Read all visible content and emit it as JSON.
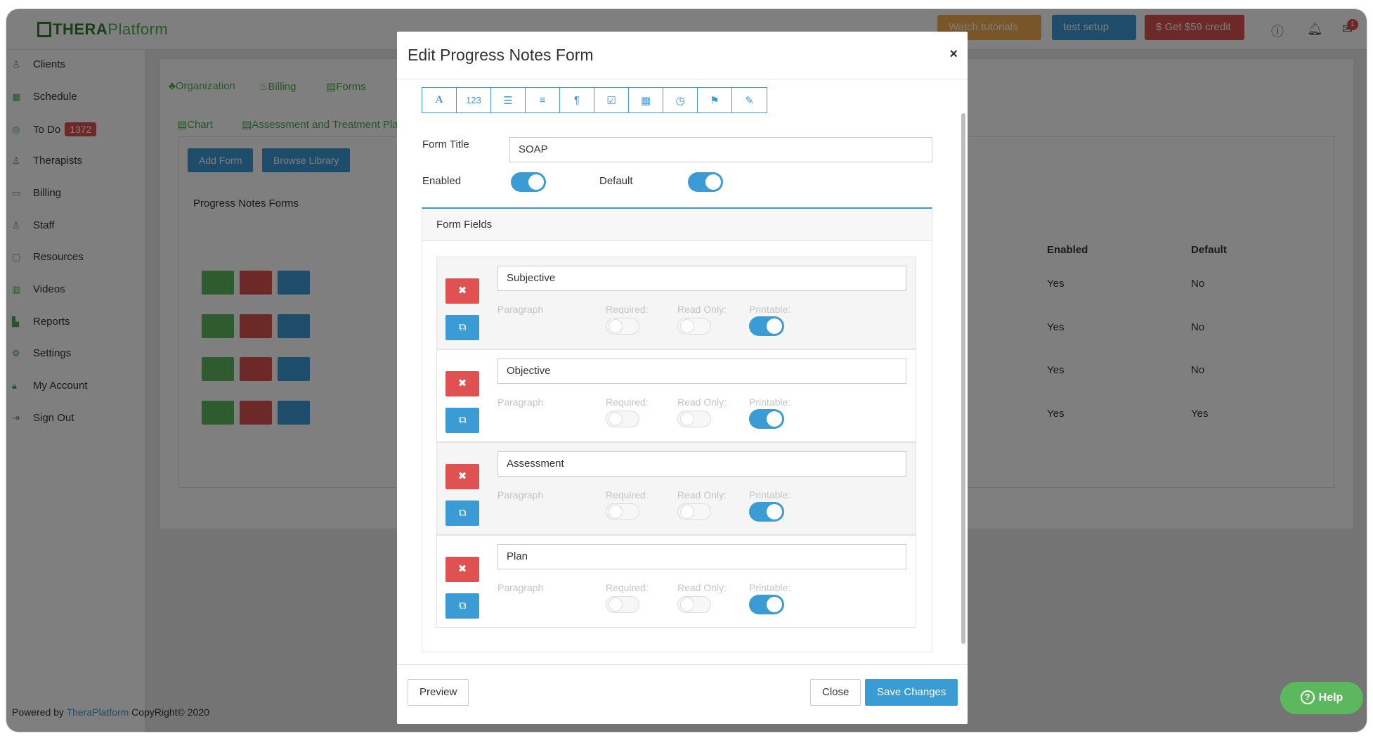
{
  "app": {
    "logo_bold": "THERA",
    "logo_light": "Platform",
    "top_buttons": {
      "tutorials": "Watch tutorials",
      "setup": "test setup",
      "credit": "$ Get $59 credit"
    },
    "notification_count": "1",
    "sidebar": [
      {
        "name": "clients",
        "label": "Clients",
        "icon": "user-icon"
      },
      {
        "name": "schedule",
        "label": "Schedule",
        "icon": "calendar-icon"
      },
      {
        "name": "todo",
        "label": "To Do",
        "icon": "check-circle-icon",
        "badge": "1372"
      },
      {
        "name": "therapists",
        "label": "Therapists",
        "icon": "user-icon"
      },
      {
        "name": "billing",
        "label": "Billing",
        "icon": "card-icon"
      },
      {
        "name": "staff",
        "label": "Staff",
        "icon": "user-icon"
      },
      {
        "name": "resources",
        "label": "Resources",
        "icon": "folder-icon"
      },
      {
        "name": "videos",
        "label": "Videos",
        "icon": "video-icon"
      },
      {
        "name": "reports",
        "label": "Reports",
        "icon": "bar-chart-icon"
      },
      {
        "name": "settings",
        "label": "Settings",
        "icon": "gear-icon"
      },
      {
        "name": "my-account",
        "label": "My Account",
        "icon": "lock-icon"
      },
      {
        "name": "sign-out",
        "label": "Sign Out",
        "icon": "sign-out-icon"
      }
    ],
    "footer": {
      "prefix": "Powered by ",
      "link": "TheraPlatform",
      "suffix": " CopyRight© 2020"
    },
    "tabs": {
      "organization": "Organization",
      "billing": "Billing",
      "forms": "Forms"
    },
    "subtabs": {
      "chart": "Chart",
      "assessment": "Assessment and Treatment Plan"
    },
    "buttons": {
      "add_form": "Add Form",
      "browse_library": "Browse Library"
    },
    "panel_title": "Progress Notes Forms",
    "columns": {
      "enabled": "Enabled",
      "default": "Default"
    },
    "rows": [
      {
        "enabled": "Yes",
        "default": "No"
      },
      {
        "enabled": "Yes",
        "default": "No"
      },
      {
        "enabled": "Yes",
        "default": "No"
      },
      {
        "enabled": "Yes",
        "default": "Yes"
      }
    ]
  },
  "modal": {
    "title": "Edit Progress Notes Form",
    "toolbar": [
      {
        "name": "text-tool",
        "glyph": "A"
      },
      {
        "name": "number-tool",
        "glyph": "123"
      },
      {
        "name": "list-tool",
        "glyph": "☰"
      },
      {
        "name": "align-tool",
        "glyph": "≡"
      },
      {
        "name": "paragraph-tool",
        "glyph": "¶"
      },
      {
        "name": "checkbox-tool",
        "glyph": "☑"
      },
      {
        "name": "calendar-tool",
        "glyph": "▦"
      },
      {
        "name": "clock-tool",
        "glyph": "◷"
      },
      {
        "name": "bookmark-tool",
        "glyph": "⚑"
      },
      {
        "name": "edit-tool",
        "glyph": "✎"
      }
    ],
    "form_title_label": "Form Title",
    "form_title_value": "SOAP",
    "enabled_label": "Enabled",
    "enabled": true,
    "default_label": "Default",
    "default": true,
    "fields_heading": "Form Fields",
    "fields": [
      {
        "name": "Subjective",
        "type": "Paragraph",
        "required": false,
        "read_only": false,
        "printable": true
      },
      {
        "name": "Objective",
        "type": "Paragraph",
        "required": false,
        "read_only": false,
        "printable": true
      },
      {
        "name": "Assessment",
        "type": "Paragraph",
        "required": false,
        "read_only": false,
        "printable": true
      },
      {
        "name": "Plan",
        "type": "Paragraph",
        "required": false,
        "read_only": false,
        "printable": true
      }
    ],
    "option_labels": {
      "required": "Required:",
      "read_only": "Read Only:",
      "printable": "Printable:"
    },
    "footer": {
      "preview": "Preview",
      "close": "Close",
      "save": "Save Changes"
    }
  },
  "help": "Help",
  "colors": {
    "accent": "#3b9bd4",
    "danger": "#e05252",
    "success": "#5cb85c"
  }
}
